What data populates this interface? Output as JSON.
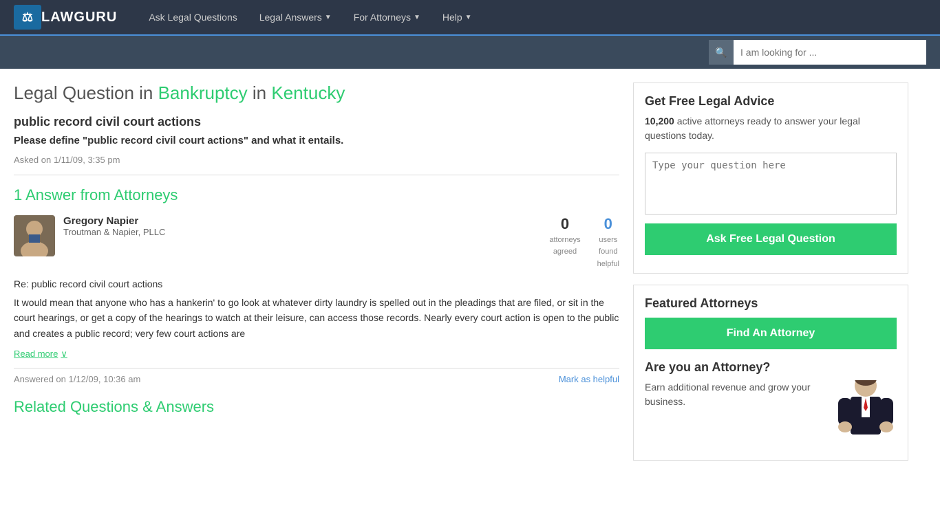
{
  "brand": {
    "name": "LAWGURU"
  },
  "nav": {
    "links": [
      {
        "id": "ask-legal",
        "label": "Ask Legal Questions",
        "hasArrow": false
      },
      {
        "id": "legal-answers",
        "label": "Legal Answers",
        "hasArrow": true
      },
      {
        "id": "for-attorneys",
        "label": "For Attorneys",
        "hasArrow": true
      },
      {
        "id": "help",
        "label": "Help",
        "hasArrow": true
      }
    ]
  },
  "search": {
    "placeholder": "I am looking for ..."
  },
  "page": {
    "title_prefix": "Legal Question in ",
    "category": "Bankruptcy",
    "title_in": " in ",
    "state": "Kentucky",
    "question_title": "public record civil court actions",
    "question_body": "Please define \"public record civil court actions\" and what it entails.",
    "asked_on": "Asked on 1/11/09, 3:35 pm"
  },
  "answers": {
    "heading": "1 Answer from Attorneys",
    "list": [
      {
        "attorney_name": "Gregory Napier",
        "attorney_firm": "Troutman & Napier, PLLC",
        "attorneys_agreed_count": "0",
        "attorneys_agreed_label": "attorneys\nagreed",
        "users_found_count": "0",
        "users_found_label": "users\nfound\nhelpful",
        "answer_re": "Re: public record civil court actions",
        "answer_text": "It would mean that anyone who has a hankerin' to go look at whatever dirty laundry is spelled out in the pleadings that are filed, or sit in the court hearings, or get a copy of the hearings to watch at their leisure, can access those records. Nearly every court action is open to the public and creates a public record; very few court actions are",
        "read_more": "Read more",
        "answered_on": "Answered on 1/12/09, 10:36 am",
        "mark_helpful": "Mark as helpful"
      }
    ]
  },
  "sidebar": {
    "get_advice_title": "Get Free Legal Advice",
    "active_count": "10,200",
    "active_text": "active attorneys ready to answer your legal questions today.",
    "question_placeholder": "Type your question here",
    "ask_btn": "Ask Free Legal Question",
    "featured_title": "Featured Attorneys",
    "find_btn": "Find An Attorney",
    "attorney_title": "Are you an Attorney?",
    "attorney_promo": "Earn additional revenue and grow your business."
  },
  "related": {
    "heading": "Related Questions & Answers"
  }
}
